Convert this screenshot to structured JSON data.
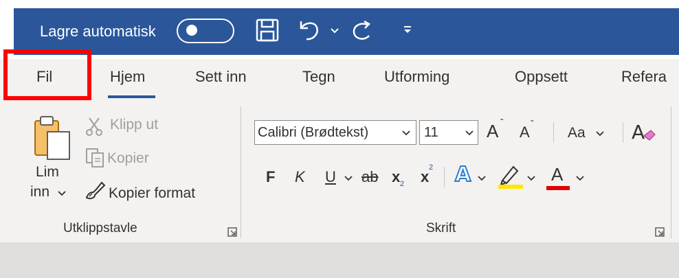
{
  "titlebar": {
    "autosave_label": "Lagre automatisk",
    "background": "#2b579a"
  },
  "tabs": [
    {
      "label": "Fil",
      "highlighted": true
    },
    {
      "label": "Hjem",
      "active": true
    },
    {
      "label": "Sett inn"
    },
    {
      "label": "Tegn"
    },
    {
      "label": "Utforming"
    },
    {
      "label": "Oppsett"
    },
    {
      "label": "Refera"
    }
  ],
  "clipboard": {
    "paste_line1": "Lim",
    "paste_line2": "inn",
    "cut": "Klipp ut",
    "copy": "Kopier",
    "format_painter": "Kopier format",
    "group_label": "Utklippstavle"
  },
  "font": {
    "font_name": "Calibri (Brødtekst)",
    "font_size": "11",
    "grow": "A",
    "shrink": "A",
    "change_case": "Aa",
    "bold": "F",
    "italic": "K",
    "underline": "U",
    "strike": "ab",
    "subscript": "x",
    "subscript_mark": "2",
    "superscript": "x",
    "superscript_mark": "2",
    "text_effects": "A",
    "font_color": "A",
    "group_label": "Skrift"
  },
  "colors": {
    "highlight_bar": "#ffe600",
    "font_color_bar": "#e00000",
    "accent": "#2b579a",
    "annotation_box": "#ff0000"
  }
}
